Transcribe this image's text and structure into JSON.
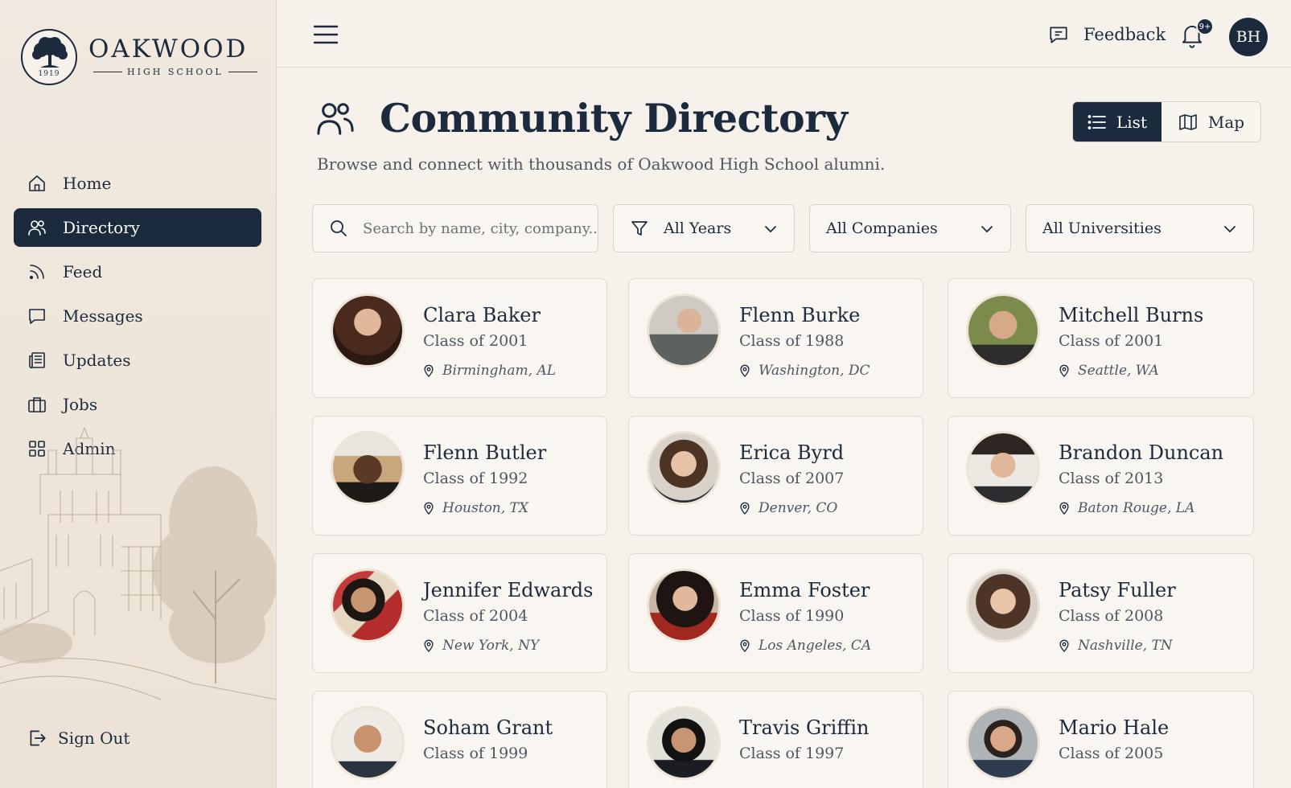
{
  "brand": {
    "name": "OAKWOOD",
    "subtitle": "HIGH SCHOOL",
    "year": "1919"
  },
  "nav": [
    {
      "label": "Home",
      "icon": "home-icon",
      "active": false
    },
    {
      "label": "Directory",
      "icon": "users-icon",
      "active": true
    },
    {
      "label": "Feed",
      "icon": "rss-icon",
      "active": false
    },
    {
      "label": "Messages",
      "icon": "message-icon",
      "active": false
    },
    {
      "label": "Updates",
      "icon": "newspaper-icon",
      "active": false
    },
    {
      "label": "Jobs",
      "icon": "briefcase-icon",
      "active": false
    },
    {
      "label": "Admin",
      "icon": "grid-icon",
      "active": false
    }
  ],
  "sign_out": "Sign Out",
  "topbar": {
    "feedback": "Feedback",
    "notifications": "9+",
    "user_initials": "BH"
  },
  "page": {
    "title": "Community Directory",
    "subtitle": "Browse and connect with thousands of Oakwood High School alumni."
  },
  "view_toggle": {
    "list": "List",
    "map": "Map",
    "selected": "List"
  },
  "filters": {
    "search_placeholder": "Search by name, city, company...",
    "years": "All Years",
    "companies": "All Companies",
    "universities": "All Universities"
  },
  "alumni": [
    {
      "name": "Clara Baker",
      "class": "Class of 2001",
      "location": "Birmingham, AL"
    },
    {
      "name": "Flenn Burke",
      "class": "Class of 1988",
      "location": "Washington, DC"
    },
    {
      "name": "Mitchell Burns",
      "class": "Class of 2001",
      "location": "Seattle, WA"
    },
    {
      "name": "Flenn Butler",
      "class": "Class of 1992",
      "location": "Houston, TX"
    },
    {
      "name": "Erica Byrd",
      "class": "Class of 2007",
      "location": "Denver, CO"
    },
    {
      "name": "Brandon Duncan",
      "class": "Class of 2013",
      "location": "Baton Rouge, LA"
    },
    {
      "name": "Jennifer Edwards",
      "class": "Class of 2004",
      "location": "New York, NY"
    },
    {
      "name": "Emma Foster",
      "class": "Class of 1990",
      "location": "Los Angeles, CA"
    },
    {
      "name": "Patsy Fuller",
      "class": "Class of 2008",
      "location": "Nashville, TN"
    },
    {
      "name": "Soham Grant",
      "class": "Class of 1999",
      "location": ""
    },
    {
      "name": "Travis Griffin",
      "class": "Class of 1997",
      "location": ""
    },
    {
      "name": "Mario Hale",
      "class": "Class of 2005",
      "location": ""
    }
  ],
  "colors": {
    "navy": "#1b2a3d",
    "background": "#f6f1ea",
    "sidebar": "#efe6db",
    "card": "#f9f5f0",
    "border": "#e2d8cb"
  }
}
